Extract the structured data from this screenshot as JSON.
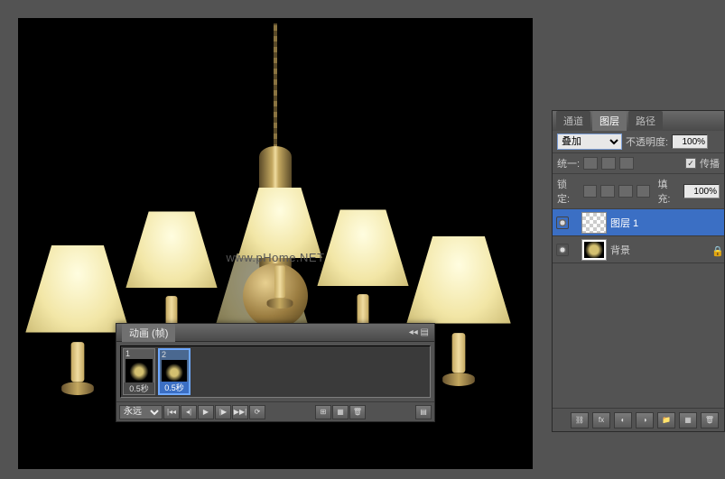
{
  "watermark": "www.pHome.NET",
  "animation": {
    "tab_label": "动画 (帧)",
    "close_glyph": "◂◂ ▤",
    "frames": [
      {
        "num": "1",
        "time": "0.5秒",
        "selected": false
      },
      {
        "num": "2",
        "time": "0.5秒",
        "selected": true
      }
    ],
    "loop_label": "永远",
    "controls": {
      "first": "|◂◂",
      "prev": "◂|",
      "play": "▶",
      "next": "|▶",
      "last": "▶▶|",
      "tween": "⟳",
      "sep": " ",
      "dup": "⊞",
      "new": "▦",
      "del": "🗑",
      "menu": "▤"
    }
  },
  "layers": {
    "tabs": {
      "channels": "通道",
      "layers": "图层",
      "paths": "路径"
    },
    "blend_mode": "叠加",
    "opacity_label": "不透明度:",
    "opacity_value": "100%",
    "unify_label": "统一:",
    "propagate_label": "传播",
    "lock_label": "锁定:",
    "fill_label": "填充:",
    "fill_value": "100%",
    "items": [
      {
        "name": "图层 1",
        "selected": true,
        "checker": true,
        "locked": false
      },
      {
        "name": "背景",
        "selected": false,
        "checker": false,
        "locked": true
      }
    ],
    "bottom_icons": {
      "link": "⛓",
      "fx": "fx",
      "mask": "◐",
      "adj": "◑",
      "group": "📁",
      "new": "▦",
      "trash": "🗑"
    }
  }
}
